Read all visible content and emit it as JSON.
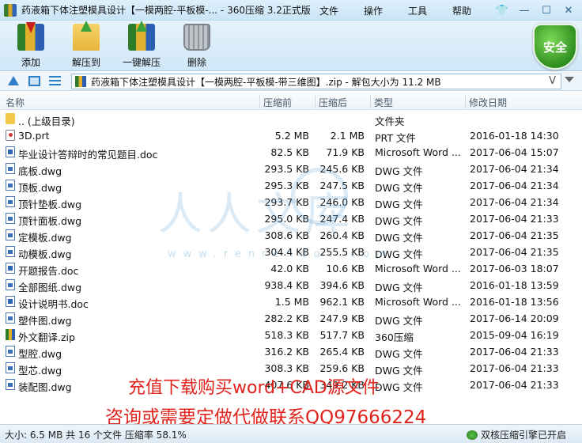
{
  "titlebar": {
    "title": "药液箱下体注塑模具设计【一模两腔-平板模-... - 360压缩 3.2正式版",
    "menus": [
      "文件",
      "操作",
      "工具",
      "帮助"
    ]
  },
  "toolbar": {
    "add": "添加",
    "extract": "解压到",
    "oneclick": "一键解压",
    "delete": "删除",
    "safe": "安全"
  },
  "address": {
    "path": "药液箱下体注塑模具设计【一模两腔-平板模-带三维图】.zip - 解包大小为 11.2 MB",
    "chevron": "V"
  },
  "columns": {
    "name": "名称",
    "size": "压缩前",
    "csize": "压缩后",
    "type": "类型",
    "date": "修改日期"
  },
  "files": [
    {
      "icon": "folder",
      "name": ".. (上级目录)",
      "size": "",
      "csize": "",
      "type": "文件夹",
      "date": ""
    },
    {
      "icon": "prt",
      "name": "3D.prt",
      "size": "5.2 MB",
      "csize": "2.1 MB",
      "type": "PRT 文件",
      "date": "2016-01-18 14:30"
    },
    {
      "icon": "doc",
      "name": "毕业设计答辩时的常见题目.doc",
      "size": "82.5 KB",
      "csize": "71.9 KB",
      "type": "Microsoft Word ...",
      "date": "2017-06-04 15:07"
    },
    {
      "icon": "dwg",
      "name": "底板.dwg",
      "size": "293.5 KB",
      "csize": "245.6 KB",
      "type": "DWG 文件",
      "date": "2017-06-04 21:34"
    },
    {
      "icon": "dwg",
      "name": "顶板.dwg",
      "size": "295.3 KB",
      "csize": "247.5 KB",
      "type": "DWG 文件",
      "date": "2017-06-04 21:34"
    },
    {
      "icon": "dwg",
      "name": "顶针垫板.dwg",
      "size": "293.7 KB",
      "csize": "246.0 KB",
      "type": "DWG 文件",
      "date": "2017-06-04 21:34"
    },
    {
      "icon": "dwg",
      "name": "顶针面板.dwg",
      "size": "295.0 KB",
      "csize": "247.4 KB",
      "type": "DWG 文件",
      "date": "2017-06-04 21:33"
    },
    {
      "icon": "dwg",
      "name": "定模板.dwg",
      "size": "308.6 KB",
      "csize": "260.4 KB",
      "type": "DWG 文件",
      "date": "2017-06-04 21:35"
    },
    {
      "icon": "dwg",
      "name": "动模板.dwg",
      "size": "304.4 KB",
      "csize": "255.5 KB",
      "type": "DWG 文件",
      "date": "2017-06-04 21:35"
    },
    {
      "icon": "doc",
      "name": "开题报告.doc",
      "size": "42.0 KB",
      "csize": "10.6 KB",
      "type": "Microsoft Word ...",
      "date": "2017-06-03 18:07"
    },
    {
      "icon": "dwg",
      "name": "全部图纸.dwg",
      "size": "938.4 KB",
      "csize": "394.6 KB",
      "type": "DWG 文件",
      "date": "2016-01-18 13:59"
    },
    {
      "icon": "doc",
      "name": "设计说明书.doc",
      "size": "1.5 MB",
      "csize": "962.1 KB",
      "type": "Microsoft Word ...",
      "date": "2016-01-18 13:56"
    },
    {
      "icon": "dwg",
      "name": "塑件图.dwg",
      "size": "282.2 KB",
      "csize": "247.9 KB",
      "type": "DWG 文件",
      "date": "2017-06-14 20:09"
    },
    {
      "icon": "zip",
      "name": "外文翻译.zip",
      "size": "518.3 KB",
      "csize": "517.7 KB",
      "type": "360压缩",
      "date": "2015-09-04 16:19"
    },
    {
      "icon": "dwg",
      "name": "型腔.dwg",
      "size": "316.2 KB",
      "csize": "265.4 KB",
      "type": "DWG 文件",
      "date": "2017-06-04 21:33"
    },
    {
      "icon": "dwg",
      "name": "型芯.dwg",
      "size": "308.3 KB",
      "csize": "259.6 KB",
      "type": "DWG 文件",
      "date": "2017-06-04 21:33"
    },
    {
      "icon": "dwg",
      "name": "装配图.dwg",
      "size": "407.6 KB",
      "csize": "349.2 KB",
      "type": "DWG 文件",
      "date": "2017-06-04 21:33"
    }
  ],
  "watermark": {
    "text": "人人文库",
    "url": "www.renrendoc.com"
  },
  "promo": {
    "line1": "充值下载购买word+CAD源文件",
    "line2": "咨询或需要定做代做联系QQ97666224"
  },
  "status": {
    "left": "大小: 6.5 MB 共 16 个文件 压缩率 58.1%",
    "right": "双核压缩引擎已开启"
  },
  "colors": {
    "promo": "#e0231c",
    "safe": "#2f8f1f",
    "accent": "#2f7fc8"
  }
}
